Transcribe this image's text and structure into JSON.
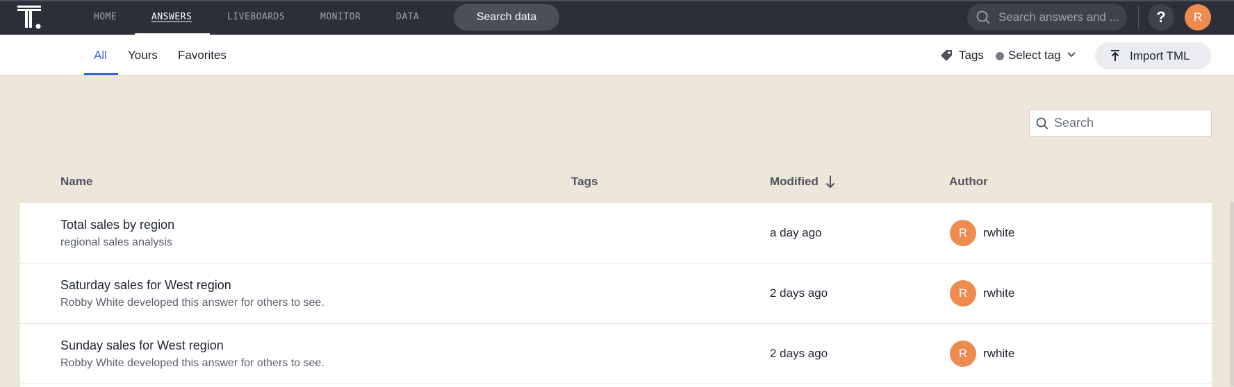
{
  "topnav": {
    "items": [
      {
        "label": "HOME",
        "active": false
      },
      {
        "label": "ANSWERS",
        "active": true
      },
      {
        "label": "LIVEBOARDS",
        "active": false
      },
      {
        "label": "MONITOR",
        "active": false
      },
      {
        "label": "DATA",
        "active": false
      }
    ],
    "search_data_label": "Search data",
    "global_search_placeholder": "Search answers and ...",
    "help_label": "?",
    "user_initial": "R"
  },
  "subnav": {
    "tabs": [
      {
        "label": "All",
        "active": true
      },
      {
        "label": "Yours",
        "active": false
      },
      {
        "label": "Favorites",
        "active": false
      }
    ],
    "tags_label": "Tags",
    "select_tag_label": "Select tag",
    "import_label": "Import TML"
  },
  "list": {
    "search_placeholder": "Search",
    "columns": {
      "name": "Name",
      "tags": "Tags",
      "modified": "Modified",
      "author": "Author"
    },
    "sort": {
      "column": "modified",
      "direction": "descending"
    },
    "rows": [
      {
        "title": "Total sales by region",
        "description": "regional sales analysis",
        "modified": "a day ago",
        "author_initial": "R",
        "author": "rwhite"
      },
      {
        "title": "Saturday sales for West region",
        "description": "Robby White developed this answer for others to see.",
        "modified": "2 days ago",
        "author_initial": "R",
        "author": "rwhite"
      },
      {
        "title": "Sunday sales for West region",
        "description": "Robby White developed this answer for others to see.",
        "modified": "2 days ago",
        "author_initial": "R",
        "author": "rwhite"
      }
    ]
  },
  "colors": {
    "nav_bg": "#2b2f38",
    "page_bg": "#ede6da",
    "accent": "#2f66e0",
    "avatar": "#ee8b4f"
  }
}
